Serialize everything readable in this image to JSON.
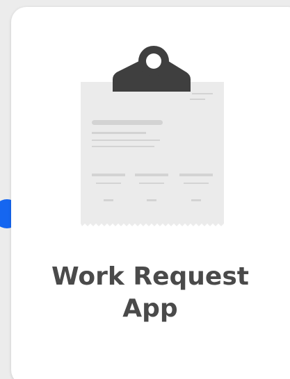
{
  "card": {
    "title_line1": "Work Request",
    "title_line2": "App",
    "icon": "clipboard-document-icon"
  },
  "colors": {
    "accent": "#1566f0",
    "clip": "#3f3f3f",
    "paper": "#ebebeb",
    "lines": "#d3d3d3",
    "title": "#4a4a4a"
  }
}
